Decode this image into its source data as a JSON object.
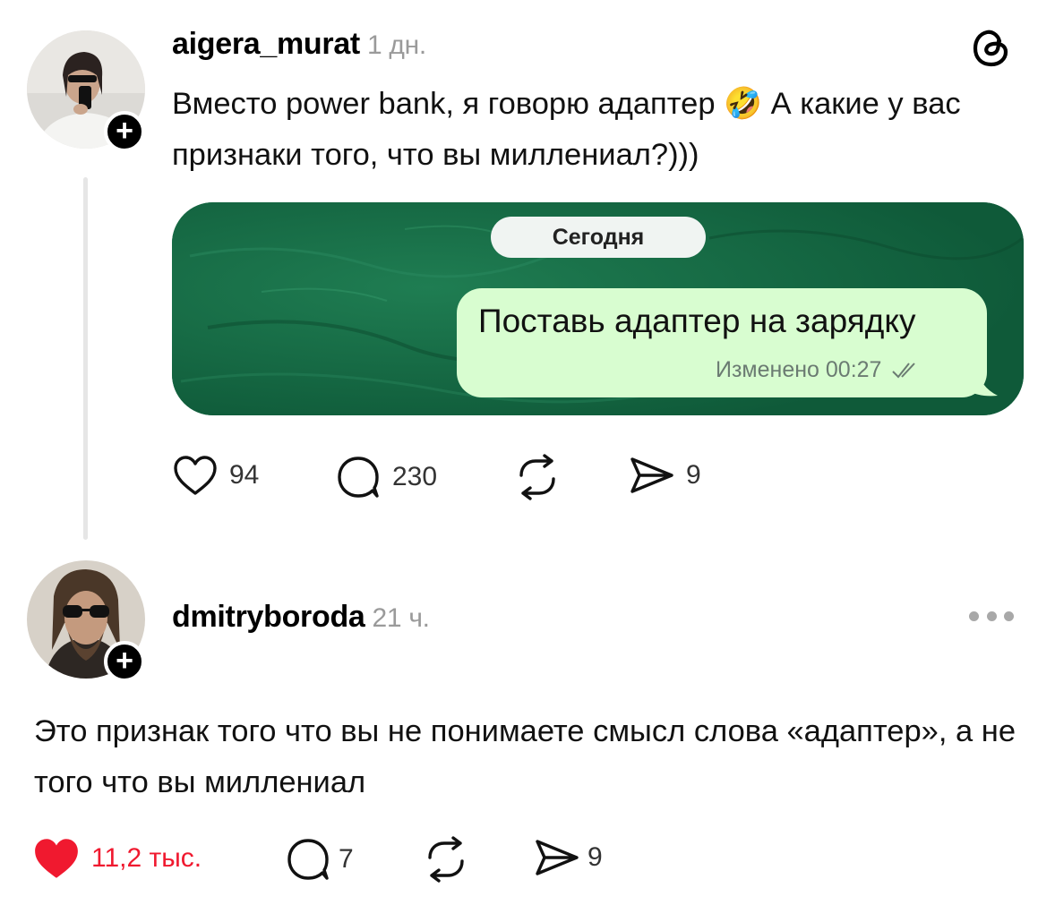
{
  "post": {
    "username": "aigera_murat",
    "time": "1 дн.",
    "text": "Вместо power bank, я говорю адаптер 🤣 А какие у вас признаки того, что вы миллениал?)))",
    "media": {
      "date_label": "Сегодня",
      "message_text": "Поставь адаптер на зарядку",
      "message_meta": "Изменено 00:27"
    },
    "actions": {
      "likes": "94",
      "comments": "230",
      "shares": "9"
    }
  },
  "reply": {
    "username": "dmitryboroda",
    "time": "21 ч.",
    "text": "Это признак того что вы не понимаете смысл слова «адаптер», а не того что вы миллениал",
    "actions": {
      "likes": "11,2 тыс.",
      "comments": "7",
      "shares": "9"
    }
  },
  "colors": {
    "like_active": "#f0192f",
    "media_bg": "#156b45",
    "bubble_bg": "#d8fdd0",
    "muted_text": "#9a9a9a"
  },
  "icons": {
    "threads_logo": "threads-logo-icon",
    "follow": "plus-icon",
    "like": "heart-icon",
    "comment": "comment-bubble-icon",
    "repost": "repost-icon",
    "share": "send-icon",
    "more": "more-dots-icon"
  }
}
